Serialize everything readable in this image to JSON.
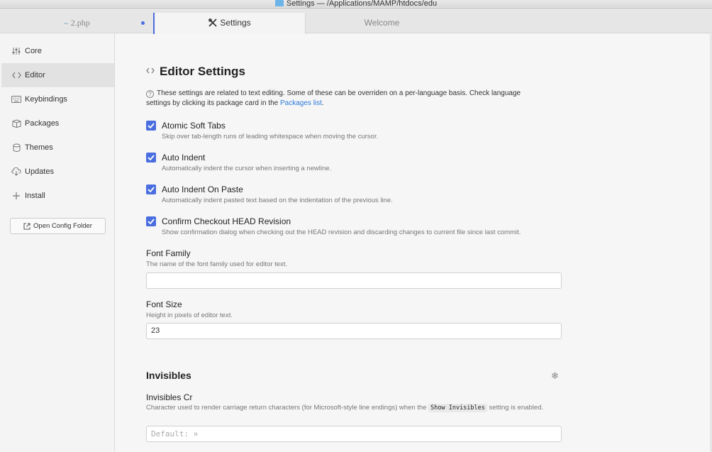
{
  "window": {
    "title": "Settings — /Applications/MAMP/htdocs/edu"
  },
  "tabs": [
    {
      "label": "2.php",
      "icon": "php-file-icon",
      "modified": true
    },
    {
      "label": "Settings",
      "icon": "tools-icon"
    },
    {
      "label": "Welcome"
    }
  ],
  "sidebar": {
    "items": [
      {
        "label": "Core",
        "icon": "sliders-icon"
      },
      {
        "label": "Editor",
        "icon": "code-icon",
        "active": true
      },
      {
        "label": "Keybindings",
        "icon": "keyboard-icon"
      },
      {
        "label": "Packages",
        "icon": "package-icon"
      },
      {
        "label": "Themes",
        "icon": "paintcan-icon"
      },
      {
        "label": "Updates",
        "icon": "cloud-download-icon"
      },
      {
        "label": "Install",
        "icon": "plus-icon"
      }
    ],
    "open_config_label": "Open Config Folder"
  },
  "editor": {
    "title": "Editor Settings",
    "note_text": "These settings are related to text editing. Some of these can be overriden on a per-language basis. Check language settings by clicking its package card in the",
    "note_link": "Packages list",
    "note_end": ".",
    "checkboxes": [
      {
        "title": "Atomic Soft Tabs",
        "desc": "Skip over tab-length runs of leading whitespace when moving the cursor.",
        "checked": true
      },
      {
        "title": "Auto Indent",
        "desc": "Automatically indent the cursor when inserting a newline.",
        "checked": true
      },
      {
        "title": "Auto Indent On Paste",
        "desc": "Automatically indent pasted text based on the indentation of the previous line.",
        "checked": true
      },
      {
        "title": "Confirm Checkout HEAD Revision",
        "desc": "Show confirmation dialog when checking out the HEAD revision and discarding changes to current file since last commit.",
        "checked": true
      }
    ],
    "font_family": {
      "title": "Font Family",
      "desc": "The name of the font family used for editor text.",
      "value": ""
    },
    "font_size": {
      "title": "Font Size",
      "desc": "Height in pixels of editor text.",
      "value": "23"
    }
  },
  "invisibles": {
    "title": "Invisibles",
    "cr": {
      "title": "Invisibles Cr",
      "desc_before": "Character used to render carriage return characters (for Microsoft-style line endings) when the",
      "desc_code": "Show Invisibles",
      "desc_after": "setting is enabled.",
      "placeholder": "Default: ¤"
    }
  },
  "colors": {
    "accent": "#4a6ee0",
    "link": "#2a7ad9"
  }
}
